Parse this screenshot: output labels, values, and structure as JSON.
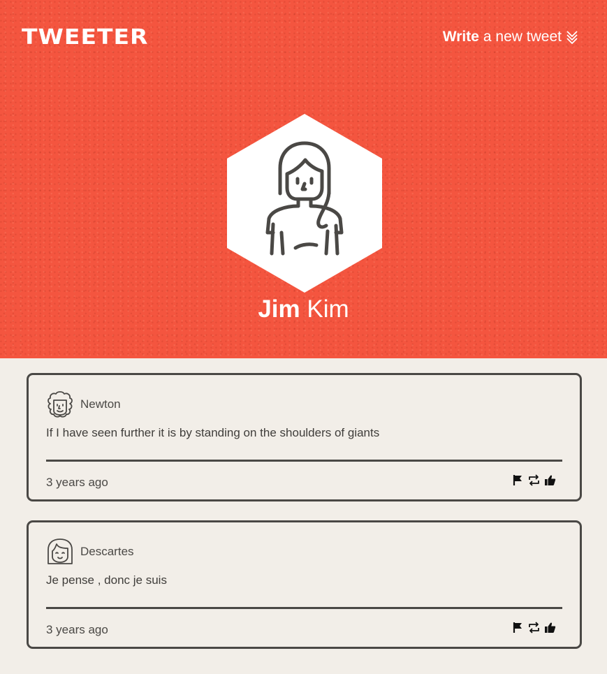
{
  "header": {
    "logo": "TWEETER",
    "compose_bold": "Write",
    "compose_rest": "a new tweet",
    "compose_icon": "double-chevron-down-icon"
  },
  "profile": {
    "first_name": "Jim",
    "last_name": "Kim",
    "avatar_icon": "woman-portrait-icon"
  },
  "colors": {
    "hero_bg": "#f4553f",
    "page_bg": "#f2eee8",
    "ink": "#4a4845",
    "white": "#ffffff"
  },
  "tweets": [
    {
      "author": "Newton",
      "avatar_icon": "newton-face-icon",
      "text": "If I have seen further it is by standing on the shoulders of giants",
      "time": "3 years ago",
      "actions": [
        "flag-icon",
        "retweet-icon",
        "like-icon"
      ]
    },
    {
      "author": "Descartes",
      "avatar_icon": "descartes-face-icon",
      "text": "Je pense , donc je suis",
      "time": "3 years ago",
      "actions": [
        "flag-icon",
        "retweet-icon",
        "like-icon"
      ]
    }
  ]
}
